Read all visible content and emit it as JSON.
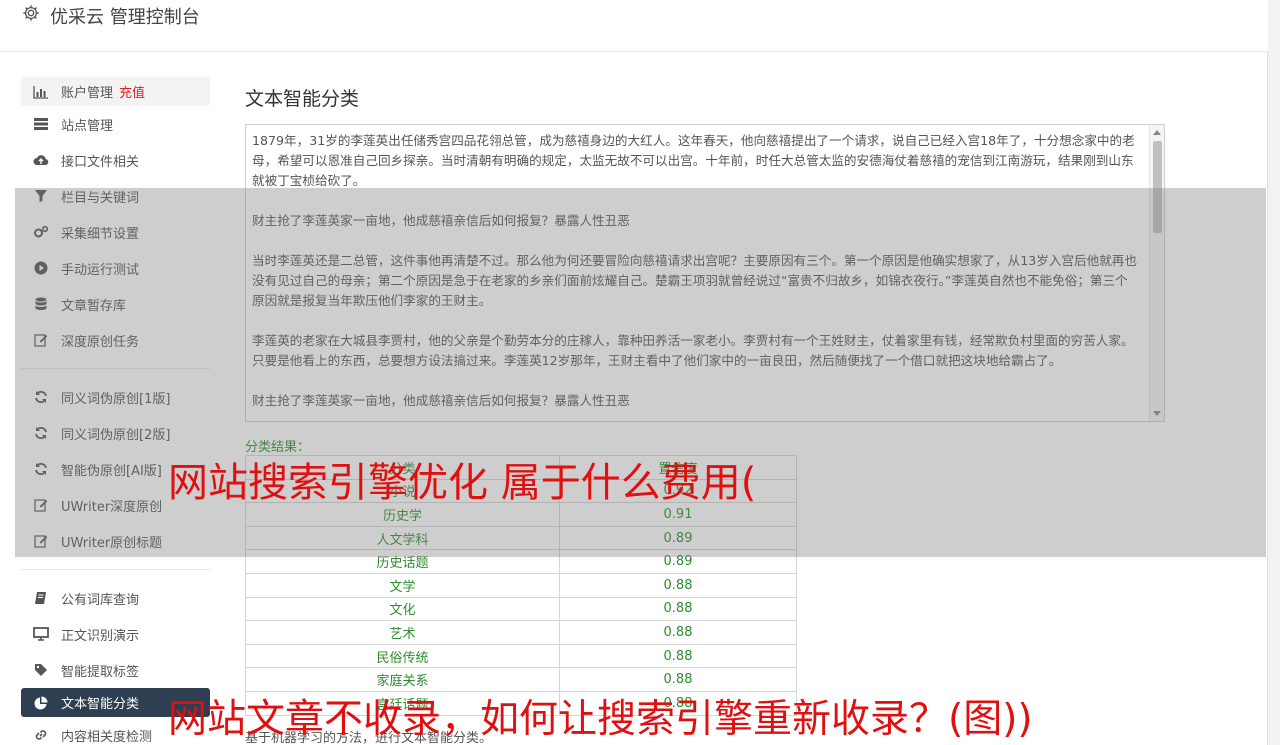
{
  "header": {
    "title": "优采云 管理控制台",
    "icon": "gear-icon"
  },
  "sidebar": {
    "group1": [
      {
        "label": "账户管理",
        "badge": "充值",
        "icon": "bar-chart-icon"
      },
      {
        "label": "站点管理",
        "icon": "server-icon"
      },
      {
        "label": "接口文件相关",
        "icon": "cloud-upload-icon"
      },
      {
        "label": "栏目与关键词",
        "icon": "filter-icon"
      },
      {
        "label": "采集细节设置",
        "icon": "gears-icon"
      },
      {
        "label": "手动运行测试",
        "icon": "play-icon"
      },
      {
        "label": "文章暂存库",
        "icon": "database-icon"
      },
      {
        "label": "深度原创任务",
        "icon": "edit-icon"
      }
    ],
    "group2": [
      {
        "label": "同义词伪原创[1版]",
        "icon": "refresh-icon"
      },
      {
        "label": "同义词伪原创[2版]",
        "icon": "refresh-icon"
      },
      {
        "label": "智能伪原创[AI版]",
        "icon": "refresh-icon"
      },
      {
        "label": "UWriter深度原创",
        "icon": "edit-icon"
      },
      {
        "label": "UWriter原创标题",
        "icon": "edit-icon"
      }
    ],
    "group3": [
      {
        "label": "公有词库查询",
        "icon": "book-icon"
      },
      {
        "label": "正文识别演示",
        "icon": "monitor-icon"
      },
      {
        "label": "智能提取标签",
        "icon": "tag-icon"
      },
      {
        "label": "文本智能分类",
        "icon": "pie-chart-icon"
      },
      {
        "label": "内容相关度检测",
        "icon": "link-icon"
      }
    ]
  },
  "main": {
    "title": "文本智能分类",
    "text": "1879年，31岁的李莲英出任储秀宫四品花翎总管，成为慈禧身边的大红人。这年春天，他向慈禧提出了一个请求，说自己已经入宫18年了，十分想念家中的老母，希望可以恩准自己回乡探亲。当时清朝有明确的规定，太监无故不可以出宫。十年前，时任大总管太监的安德海仗着慈禧的宠信到江南游玩，结果刚到山东就被丁宝桢给砍了。\n\n财主抢了李莲英家一亩地，他成慈禧亲信后如何报复？暴露人性丑恶\n\n当时李莲英还是二总管，这件事他再清楚不过。那么他为何还要冒险向慈禧请求出宫呢？主要原因有三个。第一个原因是他确实想家了，从13岁入宫后他就再也没有见过自己的母亲；第二个原因是急于在老家的乡亲们面前炫耀自己。楚霸王项羽就曾经说过“富贵不归故乡，如锦衣夜行。”李莲英自然也不能免俗；第三个原因就是报复当年欺压他们李家的王财主。\n\n李莲英的老家在大城县李贾村，他的父亲是个勤劳本分的庄稼人，靠种田养活一家老小。李贾村有一个王姓财主，仗着家里有钱，经常欺负村里面的穷苦人家。只要是他看上的东西，总要想方设法搞过来。李莲英12岁那年，王财主看中了他们家中的一亩良田，然后随便找了一个借口就把这块地给霸占了。\n\n财主抢了李莲英家一亩地，他成慈禧亲信后如何报复？暴露人性丑恶",
    "result_label": "分类结果：",
    "table": {
      "headers": [
        "分类",
        "置信度"
      ],
      "rows": [
        [
          "小说",
          "0.92"
        ],
        [
          "历史学",
          "0.91"
        ],
        [
          "人文学科",
          "0.89"
        ],
        [
          "历史话题",
          "0.89"
        ],
        [
          "文学",
          "0.88"
        ],
        [
          "文化",
          "0.88"
        ],
        [
          "艺术",
          "0.88"
        ],
        [
          "民俗传统",
          "0.88"
        ],
        [
          "家庭关系",
          "0.88"
        ],
        [
          "宫廷话题",
          "0.88"
        ]
      ]
    },
    "footnote": "基于机器学习的方法，进行文本智能分类。"
  },
  "overlay_text": {
    "line1": "网站搜索引擎优化 属于什么费用(",
    "line2": "网站文章不收录，如何让搜索引擎重新收录？(图))"
  },
  "colors": {
    "accent_active": "#2f3f52",
    "result_green": "#2e8b2e",
    "badge_red": "#e02020",
    "ad_red": "#e01010"
  }
}
